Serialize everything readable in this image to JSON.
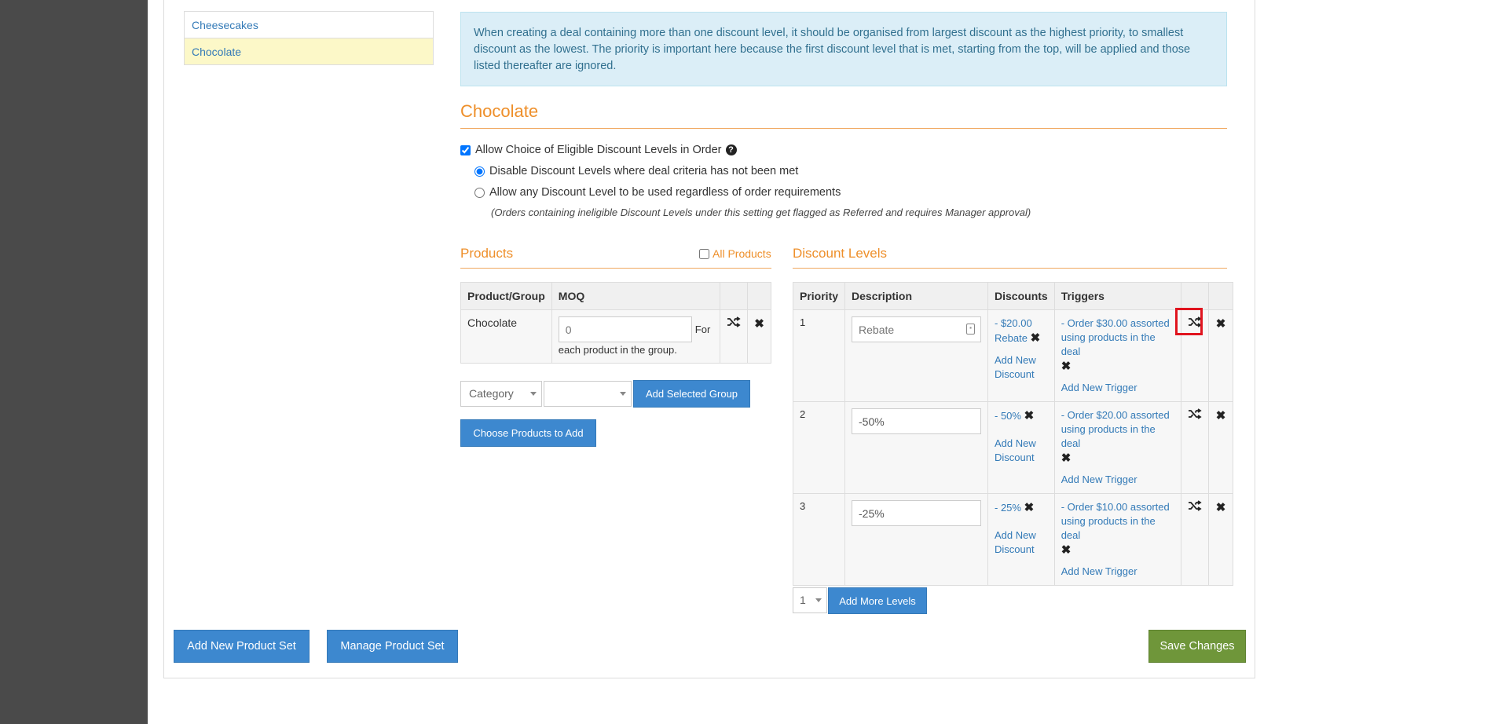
{
  "product_sets": [
    {
      "label": "Cheesecakes"
    },
    {
      "label": "Chocolate"
    }
  ],
  "info_text": "When creating a deal containing more than one discount level, it should be organised from largest discount as the highest priority, to smallest discount as the lowest. The priority is important here because the first discount level that is met, starting from the top, will be applied and those listed thereafter are ignored.",
  "section_title": "Chocolate",
  "options": {
    "allow_choice_label": "Allow Choice of Eligible Discount Levels in Order",
    "disable_label": "Disable Discount Levels where deal criteria has not been met",
    "allow_any_label": "Allow any Discount Level to be used regardless of order requirements",
    "note": "(Orders containing ineligible Discount Levels under this setting get flagged as Referred and requires Manager approval)"
  },
  "products": {
    "title": "Products",
    "all_products_label": "All Products",
    "columns": [
      "Product/Group",
      "MOQ"
    ],
    "rows": [
      {
        "name": "Chocolate",
        "moq_placeholder": "0",
        "for_text": "For",
        "each_text": "each product in the group."
      }
    ],
    "category_select": "Category",
    "add_group_button": "Add Selected Group",
    "choose_products_button": "Choose Products to Add"
  },
  "discount_levels": {
    "title": "Discount Levels",
    "columns": [
      "Priority",
      "Description",
      "Discounts",
      "Triggers"
    ],
    "rows": [
      {
        "priority": "1",
        "description_placeholder": "Rebate",
        "description_value": "",
        "discount": "- $20.00 Rebate",
        "add_discount": "Add New Discount",
        "trigger": "- Order $30.00 assorted using products in the deal",
        "add_trigger": "Add New Trigger"
      },
      {
        "priority": "2",
        "description_placeholder": "",
        "description_value": "-50%",
        "discount": "- 50%",
        "add_discount": "Add New Discount",
        "trigger": "- Order $20.00 assorted using products in the deal",
        "add_trigger": "Add New Trigger"
      },
      {
        "priority": "3",
        "description_placeholder": "",
        "description_value": "-25%",
        "discount": "- 25%",
        "add_discount": "Add New Discount",
        "trigger": "- Order $10.00 assorted using products in the deal",
        "add_trigger": "Add New Trigger"
      }
    ],
    "levels_select": "1",
    "add_levels_button": "Add More Levels"
  },
  "footer": {
    "add_set_button": "Add New Product Set",
    "manage_set_button": "Manage Product Set",
    "save_button": "Save Changes"
  },
  "colors": {
    "accent_orange": "#ee8f2a",
    "primary_blue": "#3d88cf",
    "save_green": "#6f963a",
    "highlight_red": "#e0141e"
  }
}
